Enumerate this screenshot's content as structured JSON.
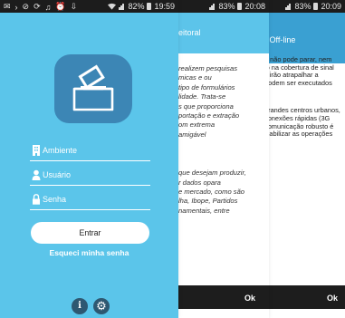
{
  "screen1": {
    "status": {
      "battery": "82%",
      "time": "19:59"
    },
    "fields": [
      {
        "label": "Ambiente",
        "icon": "building-icon"
      },
      {
        "label": "Usuário",
        "icon": "person-icon"
      },
      {
        "label": "Senha",
        "icon": "lock-icon"
      }
    ],
    "login_button": "Entrar",
    "forgot_link": "Esqueci minha senha",
    "bottom_icons": [
      "info-icon",
      "gear-icon"
    ],
    "colors": {
      "background": "#5bc5ea",
      "logo_box": "#3c86b5",
      "round_buttons": "#2e5871"
    }
  },
  "screen2": {
    "status": {
      "battery": "83%",
      "time": "20:08"
    },
    "title": "leitoral",
    "paragraph1": [
      "realizem pesquisas",
      "micas e ou",
      "tipo de formulários",
      "lidade. Trata-se",
      "s que proporciona",
      "portação e extração",
      "om extrema",
      "amigável"
    ],
    "paragraph2": [
      "que desejam produzir,",
      "r dados opara",
      "e mercado, como são",
      "lha, Ibope, Partidos",
      "namentais, entre"
    ],
    "ok_button": "Ok",
    "colors": {
      "appbar": "#5cc4ea"
    }
  },
  "screen3": {
    "status": {
      "battery": "83%",
      "time": "20:09"
    },
    "title": "u Off-line",
    "paragraph1": [
      "o não pode parar, nem",
      "lo na cobertura de sinal",
      "s irão atrapalhar a",
      "podem ser executados"
    ],
    "paragraph2": [
      "grandes centros urbanos,",
      "conexões rápidas (3G",
      "comunicação robusto é",
      "viabilizar as operações"
    ],
    "ok_button": "Ok",
    "colors": {
      "appbar": "#3aa0d2"
    }
  }
}
